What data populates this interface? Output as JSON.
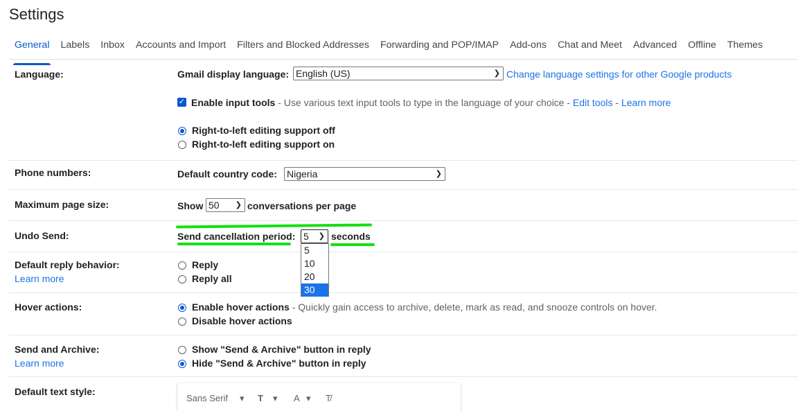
{
  "page": {
    "title": "Settings"
  },
  "tabs": [
    {
      "label": "General",
      "active": true
    },
    {
      "label": "Labels"
    },
    {
      "label": "Inbox"
    },
    {
      "label": "Accounts and Import"
    },
    {
      "label": "Filters and Blocked Addresses"
    },
    {
      "label": "Forwarding and POP/IMAP"
    },
    {
      "label": "Add-ons"
    },
    {
      "label": "Chat and Meet"
    },
    {
      "label": "Advanced"
    },
    {
      "label": "Offline"
    },
    {
      "label": "Themes"
    }
  ],
  "language": {
    "label": "Language:",
    "display_label": "Gmail display language:",
    "display_value": "English (US)",
    "change_link": "Change language settings for other Google products",
    "input_tools_label": "Enable input tools",
    "input_tools_desc": " - Use various text input tools to type in the language of your choice - ",
    "edit_tools": "Edit tools",
    "dash": " - ",
    "learn_more": "Learn more",
    "rtl_off": "Right-to-left editing support off",
    "rtl_on": "Right-to-left editing support on"
  },
  "phone": {
    "label": "Phone numbers:",
    "country_label": "Default country code:",
    "country_value": "Nigeria"
  },
  "page_size": {
    "label": "Maximum page size:",
    "show": "Show",
    "value": "50",
    "suffix": "conversations per page"
  },
  "undo": {
    "label": "Undo Send:",
    "period_label": "Send cancellation period:",
    "value": "5",
    "suffix": "seconds",
    "options": [
      "5",
      "10",
      "20",
      "30"
    ],
    "highlighted": "30"
  },
  "reply": {
    "label": "Default reply behavior:",
    "learn_more": "Learn more",
    "reply": "Reply",
    "reply_all": "Reply all"
  },
  "hover": {
    "label": "Hover actions:",
    "enable": "Enable hover actions",
    "enable_desc": " - Quickly gain access to archive, delete, mark as read, and snooze controls on hover.",
    "disable": "Disable hover actions"
  },
  "send_archive": {
    "label": "Send and Archive:",
    "learn_more": "Learn more",
    "show": "Show \"Send & Archive\" button in reply",
    "hide": "Hide \"Send & Archive\" button in reply"
  },
  "text_style": {
    "label": "Default text style:",
    "font": "Sans Serif"
  },
  "colors": {
    "accent": "#0b57d0",
    "highlight": "#13e012"
  }
}
